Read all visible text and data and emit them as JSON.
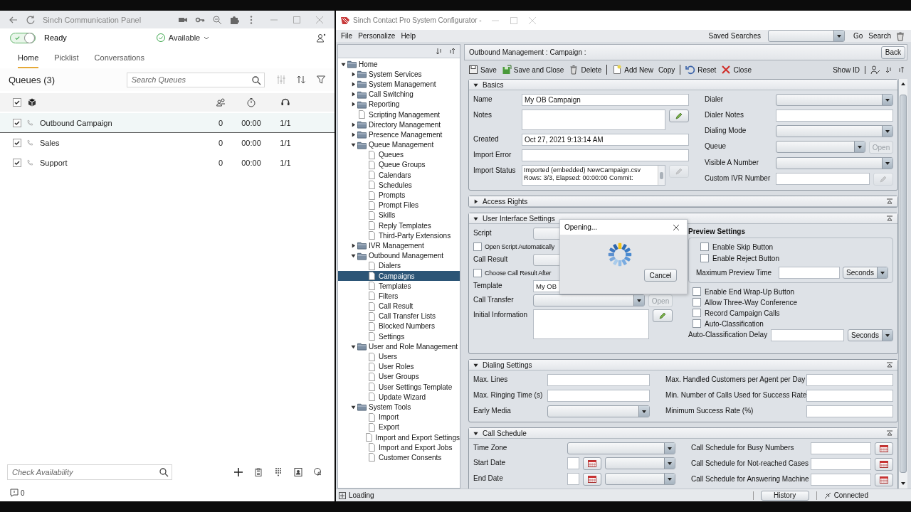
{
  "left_panel": {
    "title": "Sinch Communication Panel",
    "status": {
      "ready_label": "Ready",
      "ready_on": true,
      "availability": "Available"
    },
    "tabs": [
      {
        "label": "Home",
        "selected": true
      },
      {
        "label": "Picklist",
        "selected": false
      },
      {
        "label": "Conversations",
        "selected": false
      }
    ],
    "queues": {
      "title": "Queues (3)",
      "search_placeholder": "Search Queues",
      "all_checked": true,
      "rows": [
        {
          "name": "Outbound Campaign",
          "checked": true,
          "selected": true,
          "waiting": "0",
          "time": "00:00",
          "agents": "1/1"
        },
        {
          "name": "Sales",
          "checked": true,
          "selected": false,
          "waiting": "0",
          "time": "00:00",
          "agents": "1/1"
        },
        {
          "name": "Support",
          "checked": true,
          "selected": false,
          "waiting": "0",
          "time": "00:00",
          "agents": "1/1"
        }
      ]
    },
    "availability_placeholder": "Check Availability",
    "notification_count": "0"
  },
  "configurator": {
    "title": "Sinch Contact Pro System Configurator -",
    "menu": [
      "File",
      "Personalize",
      "Help"
    ],
    "saved_searches_label": "Saved Searches",
    "go": "Go",
    "search": "Search",
    "tree": [
      {
        "label": "Home",
        "kind": "folder",
        "expanded": true,
        "selected": false,
        "children": [
          {
            "label": "System Services",
            "kind": "folder",
            "expanded": false,
            "selected": false
          },
          {
            "label": "System Management",
            "kind": "folder",
            "expanded": false,
            "selected": false
          },
          {
            "label": "Call Switching",
            "kind": "folder",
            "expanded": false,
            "selected": false
          },
          {
            "label": "Reporting",
            "kind": "folder",
            "expanded": false,
            "selected": false
          },
          {
            "label": "Scripting Management",
            "kind": "page",
            "selected": false
          },
          {
            "label": "Directory Management",
            "kind": "folder",
            "expanded": false,
            "selected": false
          },
          {
            "label": "Presence Management",
            "kind": "folder",
            "expanded": false,
            "selected": false
          },
          {
            "label": "Queue Management",
            "kind": "folder",
            "expanded": true,
            "selected": false,
            "children": [
              {
                "label": "Queues",
                "kind": "page",
                "selected": false
              },
              {
                "label": "Queue Groups",
                "kind": "page",
                "selected": false
              },
              {
                "label": "Calendars",
                "kind": "page",
                "selected": false
              },
              {
                "label": "Schedules",
                "kind": "page",
                "selected": false
              },
              {
                "label": "Prompts",
                "kind": "page",
                "selected": false
              },
              {
                "label": "Prompt Files",
                "kind": "page",
                "selected": false
              },
              {
                "label": "Skills",
                "kind": "page",
                "selected": false
              },
              {
                "label": "Reply Templates",
                "kind": "page",
                "selected": false
              },
              {
                "label": "Third-Party Extensions",
                "kind": "page",
                "selected": false
              }
            ]
          },
          {
            "label": "IVR Management",
            "kind": "folder",
            "expanded": false,
            "selected": false
          },
          {
            "label": "Outbound Management",
            "kind": "folder",
            "expanded": true,
            "selected": false,
            "children": [
              {
                "label": "Dialers",
                "kind": "page",
                "selected": false
              },
              {
                "label": "Campaigns",
                "kind": "page",
                "selected": true
              },
              {
                "label": "Templates",
                "kind": "page",
                "selected": false
              },
              {
                "label": "Filters",
                "kind": "page",
                "selected": false
              },
              {
                "label": "Call Result",
                "kind": "page",
                "selected": false
              },
              {
                "label": "Call Transfer Lists",
                "kind": "page",
                "selected": false
              },
              {
                "label": "Blocked Numbers",
                "kind": "page",
                "selected": false
              },
              {
                "label": "Settings",
                "kind": "page",
                "selected": false
              }
            ]
          },
          {
            "label": "User and Role Management",
            "kind": "folder",
            "expanded": true,
            "selected": false,
            "children": [
              {
                "label": "Users",
                "kind": "page",
                "selected": false
              },
              {
                "label": "User Roles",
                "kind": "page",
                "selected": false
              },
              {
                "label": "User Groups",
                "kind": "page",
                "selected": false
              },
              {
                "label": "User Settings Template",
                "kind": "page",
                "selected": false
              },
              {
                "label": "Update Wizard",
                "kind": "page",
                "selected": false
              }
            ]
          },
          {
            "label": "System Tools",
            "kind": "folder",
            "expanded": true,
            "selected": false,
            "children": [
              {
                "label": "Import",
                "kind": "page",
                "selected": false
              },
              {
                "label": "Export",
                "kind": "page",
                "selected": false
              },
              {
                "label": "Import and Export Settings",
                "kind": "page",
                "selected": false
              },
              {
                "label": "Import and Export Jobs",
                "kind": "page",
                "selected": false
              },
              {
                "label": "Customer Consents",
                "kind": "page",
                "selected": false
              }
            ]
          }
        ]
      }
    ],
    "breadcrumb": "Outbound Management : Campaign :",
    "back": "Back",
    "toolbar": [
      {
        "kind": "save",
        "label": "Save",
        "separator_before": false
      },
      {
        "kind": "save_close",
        "label": "Save and Close",
        "separator_before": false
      },
      {
        "kind": "delete",
        "label": "Delete",
        "separator_before": false
      },
      {
        "kind": "add",
        "label": "Add New",
        "separator_before": true
      },
      {
        "kind": "copy",
        "label": "Copy",
        "separator_before": false
      },
      {
        "kind": "reset",
        "label": "Reset",
        "separator_before": true
      },
      {
        "kind": "close",
        "label": "Close",
        "separator_before": false
      }
    ],
    "show_id": "Show ID",
    "sections": [
      {
        "title": "Basics",
        "expanded": true,
        "columns": [
          [
            {
              "kind": "text",
              "label": "Name",
              "value": "My OB Campaign"
            },
            {
              "kind": "area",
              "label": "Notes",
              "pencil": {
                "disabled": false
              }
            },
            {
              "kind": "text",
              "label": "Created",
              "value": "Oct 27, 2021 9:13:14 AM"
            },
            {
              "kind": "text",
              "label": "Import Error"
            },
            {
              "kind": "area",
              "label": "Import Status",
              "lines": [
                "Imported (embedded) NewCampaign.csv",
                "Rows: 3/3, Elapsed: 00:00:00 Commit:"
              ],
              "pencil": {
                "disabled": true
              }
            }
          ],
          [
            {
              "kind": "combo",
              "label": "Dialer"
            },
            {
              "kind": "text",
              "label": "Dialer Notes"
            },
            {
              "kind": "combo",
              "label": "Dialing Mode"
            },
            {
              "kind": "combo",
              "label": "Queue",
              "open": {
                "label": "Open",
                "disabled": true
              }
            },
            {
              "kind": "combo",
              "label": "Visible A Number"
            },
            {
              "kind": "text",
              "label": "Custom IVR Number",
              "pencil": {
                "disabled": true
              }
            }
          ]
        ]
      },
      {
        "title": "Access Rights",
        "expanded": false
      },
      {
        "title": "User Interface Settings",
        "expanded": true,
        "columns": [
          [
            {
              "kind": "blank",
              "label": "Script"
            },
            {
              "kind": "check",
              "label": "Open Script Automatically",
              "checked": false
            },
            {
              "kind": "blank",
              "label": "Call Result"
            },
            {
              "kind": "check",
              "label": "Choose Call Result After",
              "checked": false
            },
            {
              "kind": "text",
              "label": "Template",
              "value": "My OB"
            },
            {
              "kind": "combo",
              "label": "Call Transfer",
              "open": {
                "label": "Open",
                "disabled": true
              }
            },
            {
              "kind": "area",
              "label": "Initial Information",
              "pencil": {
                "disabled": false
              }
            }
          ],
          [
            {
              "kind": "group",
              "label": "Preview Settings",
              "fields": [
                {
                  "kind": "check",
                  "label": "Enable Skip Button",
                  "checked": false
                },
                {
                  "kind": "check",
                  "label": "Enable Reject Button",
                  "checked": false
                },
                {
                  "kind": "text",
                  "label": "Maximum Preview Time",
                  "unit": "Seconds"
                }
              ]
            },
            {
              "kind": "check",
              "label": "Enable End Wrap-Up Button",
              "checked": false
            },
            {
              "kind": "check",
              "label": "Allow Three-Way Conference",
              "checked": false
            },
            {
              "kind": "check",
              "label": "Record Campaign Calls",
              "checked": false
            },
            {
              "kind": "check",
              "label": "Auto-Classification",
              "checked": false
            },
            {
              "kind": "text",
              "label": "Auto-Classification Delay",
              "unit": "Seconds"
            }
          ]
        ]
      },
      {
        "title": "Dialing Settings",
        "expanded": true,
        "columns": [
          [
            {
              "kind": "text",
              "label": "Max. Lines"
            },
            {
              "kind": "text",
              "label": "Max. Ringing Time (s)"
            },
            {
              "kind": "combo",
              "label": "Early Media"
            }
          ],
          [
            {
              "kind": "text",
              "label": "Max. Handled Customers per Agent per Day"
            },
            {
              "kind": "text",
              "label": "Min. Number of Calls Used for Success Rate"
            },
            {
              "kind": "text",
              "label": "Minimum Success Rate (%)"
            }
          ]
        ]
      },
      {
        "title": "Call Schedule",
        "expanded": true,
        "columns": [
          [
            {
              "kind": "combo",
              "label": "Time Zone"
            },
            {
              "kind": "date",
              "label": "Start Date"
            },
            {
              "kind": "date",
              "label": "End Date"
            }
          ],
          [
            {
              "kind": "text",
              "label": "Call Schedule for Busy Numbers",
              "calendar": true
            },
            {
              "kind": "text",
              "label": "Call Schedule for Not-reached Cases",
              "calendar": true
            },
            {
              "kind": "text",
              "label": "Call Schedule for Answering Machine",
              "calendar": true
            }
          ]
        ]
      }
    ],
    "status_bar": {
      "loading": "Loading",
      "history": "History",
      "connection": "Connected"
    }
  },
  "dialog": {
    "title": "Opening...",
    "cancel": "Cancel"
  }
}
